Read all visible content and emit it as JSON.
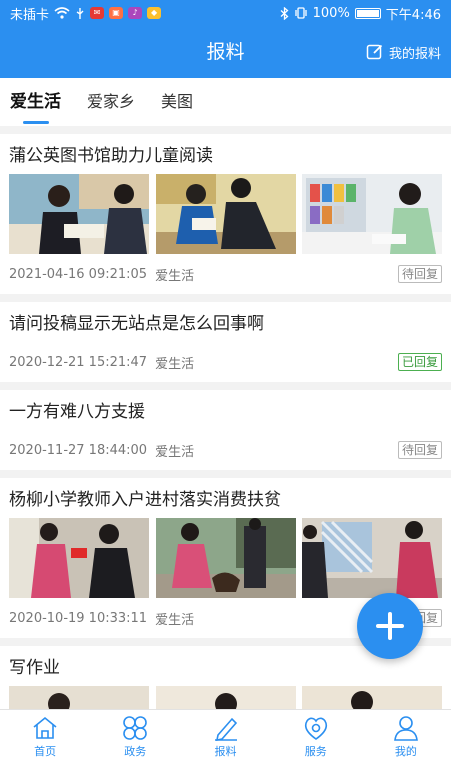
{
  "status_bar": {
    "carrier": "未插卡",
    "battery": "100%",
    "time": "下午4:46"
  },
  "header": {
    "title": "报料",
    "action_label": "我的报料"
  },
  "tabs": [
    {
      "label": "爱生活",
      "active": true
    },
    {
      "label": "爱家乡",
      "active": false
    },
    {
      "label": "美图",
      "active": false
    }
  ],
  "posts": [
    {
      "title": "蒲公英图书馆助力儿童阅读",
      "datetime": "2021-04-16 09:21:05",
      "category": "爱生活",
      "status": "待回复",
      "has_images": true
    },
    {
      "title": "请问投稿显示无站点是怎么回事啊",
      "datetime": "2020-12-21 15:21:47",
      "category": "爱生活",
      "status": "已回复",
      "has_images": false
    },
    {
      "title": "一方有难八方支援",
      "datetime": "2020-11-27 18:44:00",
      "category": "爱生活",
      "status": "待回复",
      "has_images": false
    },
    {
      "title": "杨柳小学教师入户进村落实消费扶贫",
      "datetime": "2020-10-19 10:33:11",
      "category": "爱生活",
      "status": "待回复",
      "has_images": true
    },
    {
      "title": "写作业",
      "has_images": true
    }
  ],
  "fab": {
    "icon": "plus-icon"
  },
  "bottom_nav": [
    {
      "label": "首页",
      "icon": "home-icon"
    },
    {
      "label": "政务",
      "icon": "grid-icon"
    },
    {
      "label": "报料",
      "icon": "pen-icon"
    },
    {
      "label": "服务",
      "icon": "service-icon"
    },
    {
      "label": "我的",
      "icon": "user-icon"
    }
  ],
  "colors": {
    "primary": "#2b8ff0",
    "replied_badge": "#4caf50",
    "pending_badge": "#bbbbbb"
  }
}
